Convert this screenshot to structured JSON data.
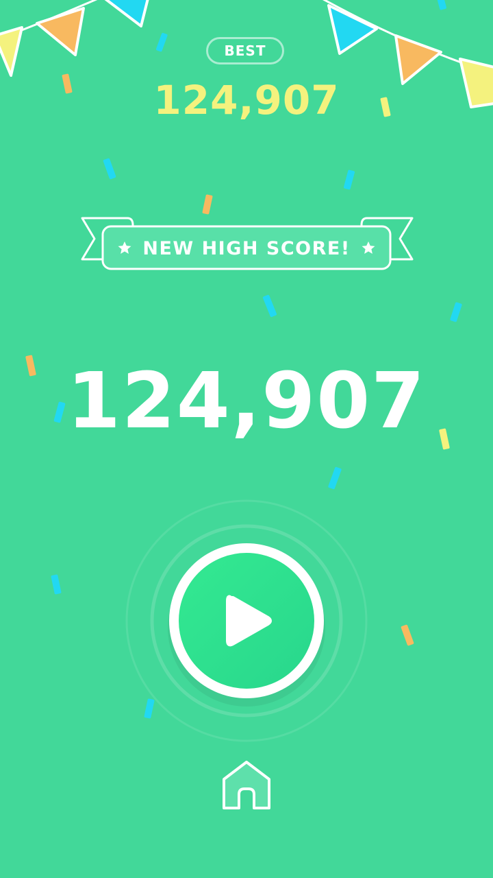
{
  "best": {
    "label": "BEST",
    "score": "124,907"
  },
  "banner": {
    "text": "NEW HIGH SCORE!",
    "left_icon": "star-icon",
    "right_icon": "star-icon"
  },
  "current": {
    "score": "124,907"
  },
  "controls": {
    "play_icon": "play-icon",
    "home_icon": "home-icon"
  },
  "colors": {
    "background": "#42d899",
    "best_score": "#f4f27e",
    "play_fill": "#2fe38f",
    "confetti_orange": "#f8b960",
    "confetti_cyan": "#22d8f2",
    "confetti_yellow": "#f4f27e"
  }
}
